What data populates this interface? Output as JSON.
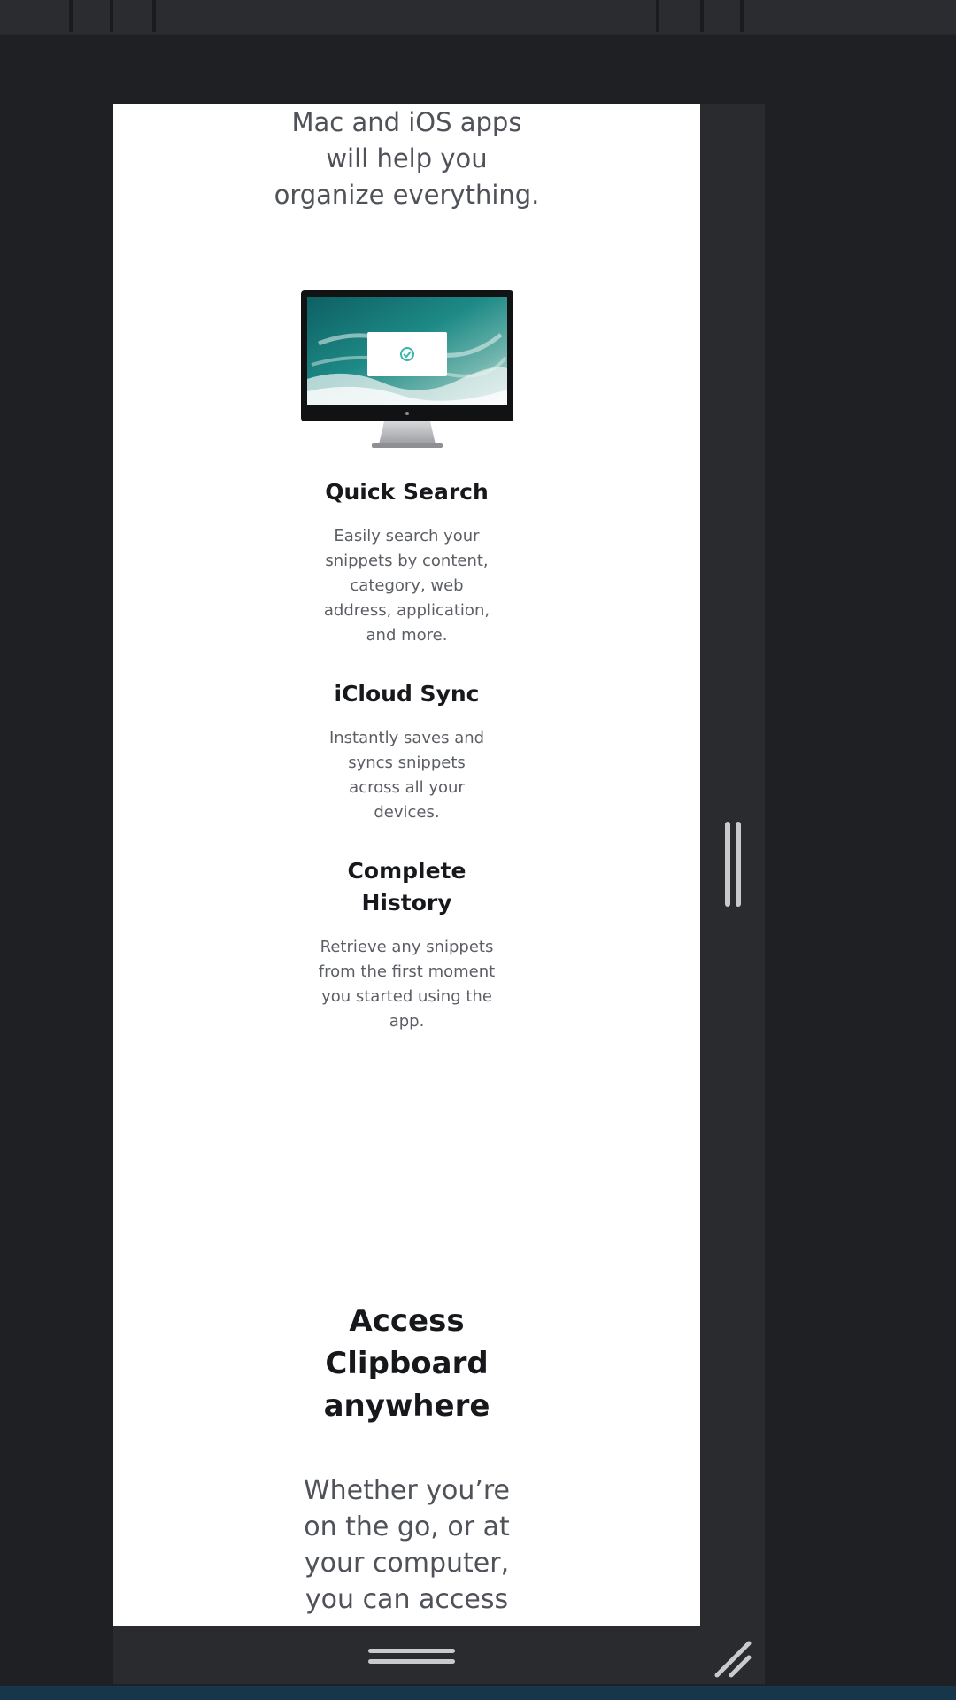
{
  "preview": {
    "intro_text": "Mac and iOS apps\nwill help you\norganize everything.",
    "features": [
      {
        "title": "Quick Search",
        "description": "Easily search your\nsnippets by content,\ncategory, web\naddress, application,\nand more."
      },
      {
        "title": "iCloud Sync",
        "description": "Instantly saves and\nsyncs snippets\nacross all your\ndevices."
      },
      {
        "title": "Complete\nHistory",
        "description": "Retrieve any snippets\nfrom the first moment\nyou started using the\napp."
      }
    ],
    "access_title": "Access\nClipboard\nanywhere",
    "access_body": "Whether you’re\non the go, or at\nyour computer,\nyou can access"
  },
  "icons": {
    "monitor": "desktop-monitor-illustration",
    "check": "check-circle-icon",
    "vertical_handle": "vertical-resize-handle-icon",
    "horizontal_handle": "horizontal-resize-handle-icon",
    "corner_handle": "corner-resize-handle-icon"
  },
  "colors": {
    "app_background": "#1f2023",
    "panel_background": "#2a2b2f",
    "page_background": "#ffffff",
    "accent": "#18364a",
    "handle": "#c9cacc",
    "heading": "#17181b",
    "body_text": "#4f5258"
  }
}
